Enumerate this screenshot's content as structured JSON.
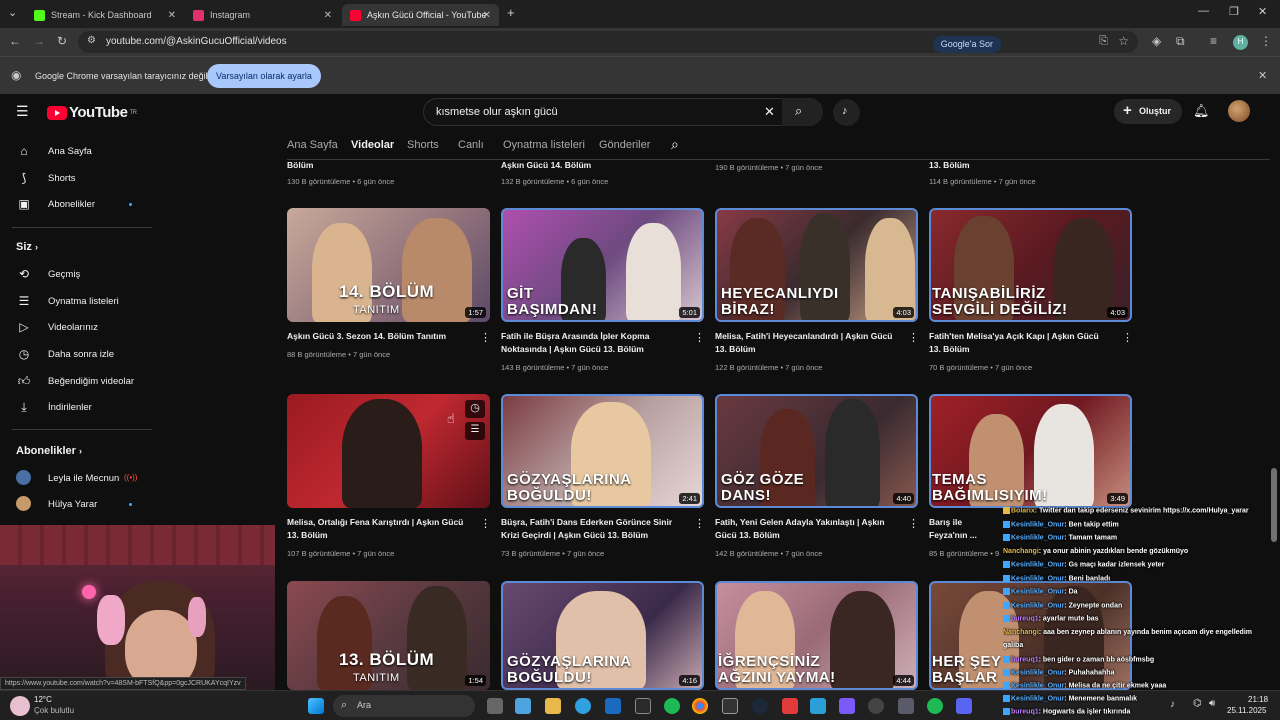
{
  "tabs": [
    {
      "title": "Stream - Kick Dashboard",
      "active": false,
      "color": "#53fc18"
    },
    {
      "title": "Instagram",
      "active": false,
      "color": "#e1306c"
    },
    {
      "title": "Aşkın Gücü Official - YouTube",
      "active": true,
      "color": "#ff0033"
    }
  ],
  "address": {
    "url": "youtube.com/@AskinGucuOfficial/videos",
    "gsor": "Google'a Sor"
  },
  "infobar": {
    "text": "Google Chrome varsayılan tarayıcınız değil",
    "button": "Varsayılan olarak ayarla"
  },
  "yt": {
    "logo": "YouTube",
    "logo_sup": "TR",
    "search": "kısmetse olur aşkın gücü",
    "create": "Oluştur"
  },
  "sidebar": {
    "main": [
      "Ana Sayfa",
      "Shorts",
      "Abonelikler"
    ],
    "you_header": "Siz",
    "you": [
      "Geçmiş",
      "Oynatma listeleri",
      "Videolarınız",
      "Daha sonra izle",
      "Beğendiğim videolar",
      "İndirilenler"
    ],
    "subs_header": "Abonelikler",
    "subs": [
      "Leyla ile Mecnun",
      "Hülya Yarar"
    ]
  },
  "channel_tabs": [
    "Ana Sayfa",
    "Videolar",
    "Shorts",
    "Canlı",
    "Oynatma listeleri",
    "Gönderiler"
  ],
  "row0": [
    {
      "title": "Bölüm",
      "meta": "130 B görüntüleme • 6 gün önce"
    },
    {
      "title": "Aşkın Gücü 14. Bölüm",
      "meta": "132 B görüntüleme • 6 gün önce"
    },
    {
      "title": "",
      "meta": "190 B görüntüleme • 7 gün önce"
    },
    {
      "title": "13. Bölüm",
      "meta": "114 B görüntüleme • 7 gün önce"
    }
  ],
  "row1": [
    {
      "cap1": "14. BÖLÜM",
      "cap2": "TANITIM",
      "dur": "1:57",
      "title": "Aşkın Gücü 3. Sezon 14. Bölüm Tanıtım",
      "meta": "88 B görüntüleme • 7 gün önce"
    },
    {
      "cap1": "GİT",
      "cap2": "BAŞIMDAN!",
      "dur": "5:01",
      "title": "Fatih ile Büşra Arasında İpler Kopma Noktasında | Aşkın Gücü 13. Bölüm",
      "meta": "143 B görüntüleme • 7 gün önce"
    },
    {
      "cap1": "HEYECANLIYDI",
      "cap2": "BİRAZ!",
      "dur": "4:03",
      "title": "Melisa, Fatih'i Heyecanlandırdı | Aşkın Gücü 13. Bölüm",
      "meta": "122 B görüntüleme • 7 gün önce"
    },
    {
      "cap1": "TANIŞABİLİRİZ",
      "cap2": "SEVGİLİ DEĞİLİZ!",
      "dur": "4:03",
      "title": "Fatih'ten Melisa'ya Açık Kapı | Aşkın Gücü 13. Bölüm",
      "meta": "70 B görüntüleme • 7 gün önce"
    }
  ],
  "row2": [
    {
      "cap1": "",
      "cap2": "",
      "dur": "",
      "title": "Melisa, Ortalığı Fena Karıştırdı | Aşkın Gücü 13. Bölüm",
      "meta": "107 B görüntüleme • 7 gün önce"
    },
    {
      "cap1": "GÖZYAŞLARINA",
      "cap2": "BOĞULDU!",
      "dur": "2:41",
      "title": "Büşra, Fatih'i Dans Ederken Görünce Sinir Krizi Geçirdi | Aşkın Gücü 13. Bölüm",
      "meta": "73 B görüntüleme • 7 gün önce"
    },
    {
      "cap1": "GÖZ GÖZE",
      "cap2": "DANS!",
      "dur": "4:40",
      "title": "Fatih, Yeni Gelen Adayla Yakınlaştı | Aşkın Gücü 13. Bölüm",
      "meta": "142 B görüntüleme • 7 gün önce"
    },
    {
      "cap1": "TEMAS",
      "cap2": "BAĞIMLISIYIM!",
      "dur": "3:49",
      "title": "Barış ile Feyza'nın ... Döndürdü | Aşkın Gücü 13. Bölüm",
      "meta": "85 B görüntüleme • 9"
    }
  ],
  "row3": [
    {
      "cap1": "13. BÖLÜM",
      "cap2": "TANITIM",
      "dur": "1:54"
    },
    {
      "cap1": "GÖZYAŞLARINA",
      "cap2": "BOĞULDU!",
      "dur": "4:16"
    },
    {
      "cap1": "İĞRENÇSİNİZ",
      "cap2": "AĞZINI YAYMA!",
      "dur": "4:44"
    },
    {
      "cap1": "HER ŞEY",
      "cap2": "BAŞLAR",
      "dur": ""
    }
  ],
  "chat": [
    {
      "user": "Bolarix",
      "text": ": Twitter dan takip ederseniz sevinirim https://x.com/Hulya_yarar"
    },
    {
      "user": "Kesinlikle_Onur",
      "text": ": Ben takip ettim"
    },
    {
      "user": "Kesinlikle_Onur",
      "text": ": Tamam tamam"
    },
    {
      "user": "Nanchangi",
      "text": ": ya onur abinin yazdıkları bende gözükmüyo"
    },
    {
      "user": "Kesinlikle_Onur",
      "text": ": Gs maçı kadar izlensek yeter"
    },
    {
      "user": "Kesinlikle_Onur",
      "text": ": Beni banladı"
    },
    {
      "user": "Kesinlikle_Onur",
      "text": ": Da"
    },
    {
      "user": "Kesinlikle_Onur",
      "text": ": Zeynepte ondan"
    },
    {
      "user": "bureuq1",
      "text": ": ayarlar mute bas"
    },
    {
      "user": "Nanchangi",
      "text": ": aaa ben zeynep ablanın yayında benim açıcam diye engelledim"
    },
    {
      "user": "",
      "text": "galiba"
    },
    {
      "user": "bureuq1",
      "text": ": ben gider o zaman bb aösbfmsbg"
    },
    {
      "user": "Kesinlikle_Onur",
      "text": ": Puhahahahha"
    },
    {
      "user": "Kesinlikle_Onur",
      "text": ": Melisa da ne çitir ekmek yaaa"
    },
    {
      "user": "Kesinlikle_Onur",
      "text": ": Menemene banmalık"
    },
    {
      "user": "bureuq1",
      "text": ": Hogwarts da işler tıkırında"
    }
  ],
  "status_url": "https://www.youtube.com/watch?v=48SM-bFTSfQ&pp=0gcJCRUKAYcqIYzv",
  "taskbar": {
    "weather_temp": "12°C",
    "weather_desc": "Çok bulutlu",
    "search": "Ara",
    "time": "21:18",
    "date": "25.11.2025"
  }
}
